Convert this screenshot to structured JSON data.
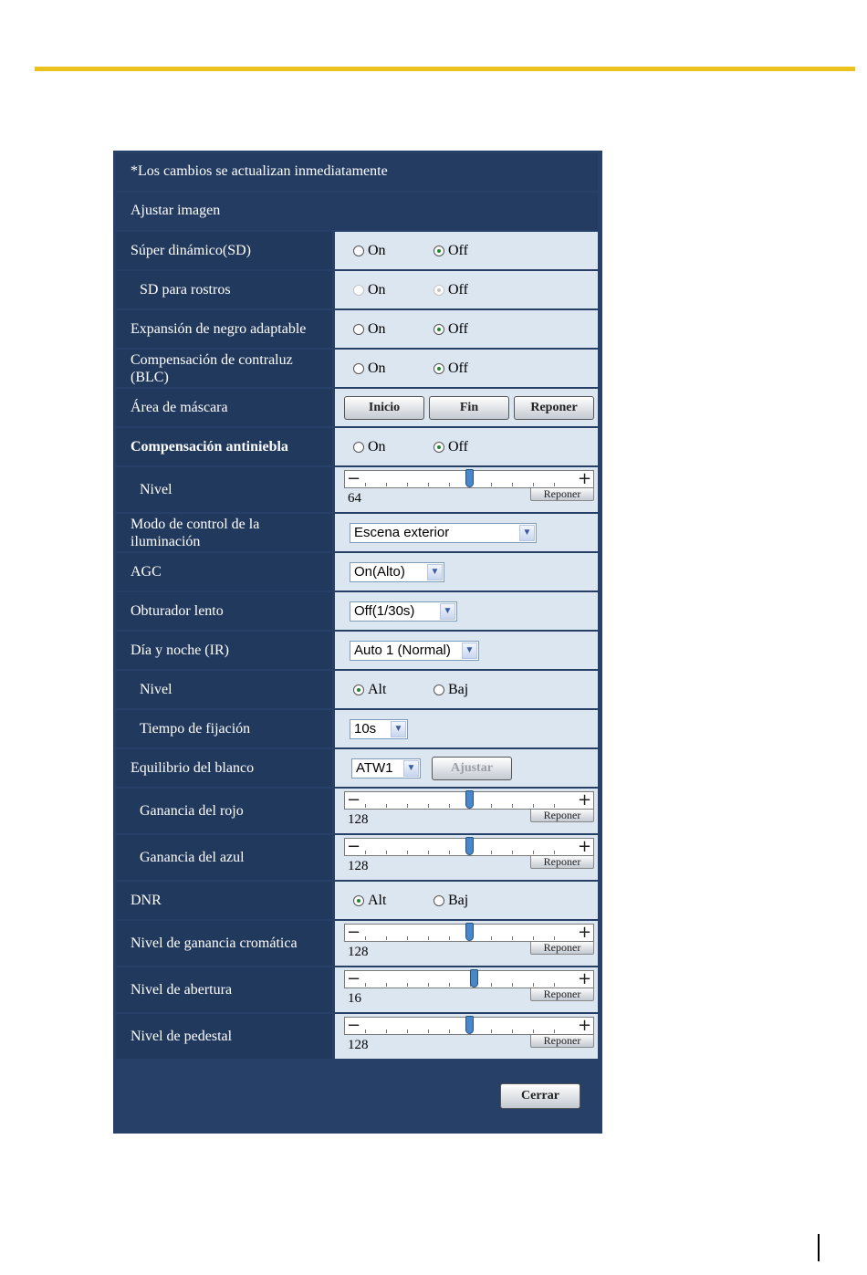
{
  "notice": "*Los cambios se actualizan inmediatamente",
  "section_title": "Ajustar imagen",
  "radio_on": "On",
  "radio_off": "Off",
  "radio_alt": "Alt",
  "radio_baj": "Baj",
  "reset_label": "Reponer",
  "rows": {
    "super_dynamic": {
      "label": "Súper dinámico(SD)",
      "selected": "Off"
    },
    "sd_faces": {
      "label": "SD para rostros",
      "selected": "Off",
      "disabled": true
    },
    "adaptive_black": {
      "label": "Expansión de negro adaptable",
      "selected": "Off"
    },
    "blc": {
      "label_line1": "Compensación de contraluz",
      "label_line2": "(BLC)",
      "selected": "Off"
    },
    "mask_area": {
      "label": "Área de máscara",
      "start_label": "Inicio",
      "end_label": "Fin",
      "reset_label": "Reponer"
    },
    "fog": {
      "label": "Compensación antiniebla",
      "selected": "Off"
    },
    "fog_level": {
      "label": "Nivel",
      "value": "64",
      "level": 0.5
    },
    "light_control": {
      "label_line1": "Modo de control de la",
      "label_line2": "iluminación",
      "selected": "Escena exterior"
    },
    "agc": {
      "label": "AGC",
      "selected": "On(Alto)"
    },
    "slow_shutter": {
      "label": "Obturador lento",
      "selected": "Off(1/30s)"
    },
    "day_night": {
      "label": "Día y noche (IR)",
      "selected": "Auto 1 (Normal)"
    },
    "dn_level": {
      "label": "Nivel",
      "selected": "Alt"
    },
    "dwell": {
      "label": "Tiempo de fijación",
      "selected": "10s"
    },
    "white_balance": {
      "label": "Equilibrio del blanco",
      "selected": "ATW1",
      "adjust_label": "Ajustar"
    },
    "red_gain": {
      "label": "Ganancia del rojo",
      "value": "128",
      "level": 0.5
    },
    "blue_gain": {
      "label": "Ganancia del azul",
      "value": "128",
      "level": 0.5
    },
    "dnr": {
      "label": "DNR",
      "selected": "Alt"
    },
    "chroma": {
      "label": "Nivel de ganancia cromática",
      "value": "128",
      "level": 0.5
    },
    "aperture": {
      "label": "Nivel de abertura",
      "value": "16",
      "level": 0.52
    },
    "pedestal": {
      "label": "Nivel de pedestal",
      "value": "128",
      "level": 0.5
    }
  },
  "close_label": "Cerrar",
  "colors": {
    "accent_rule": "#ecc21c",
    "panel": "#264068",
    "control_bg": "#dce6f1",
    "radio_selected": "#1c8a2c"
  }
}
